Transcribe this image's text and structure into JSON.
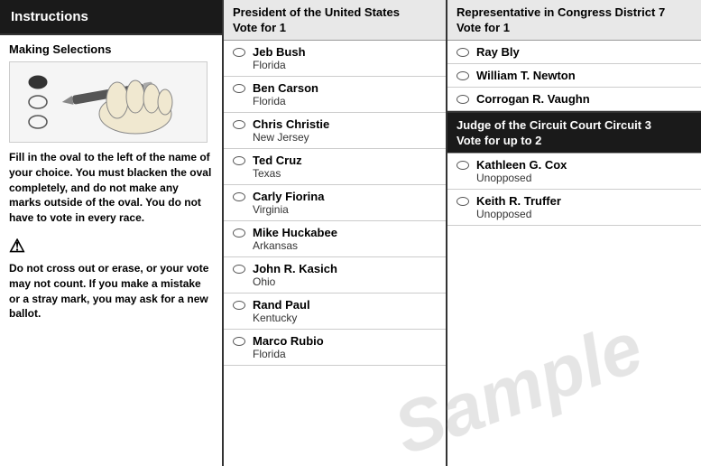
{
  "instructions": {
    "header": "Instructions",
    "making_selections": "Making Selections",
    "fill_in_text": "Fill in the oval to the left of the name of your choice. You must blacken the oval completely, and do not make any marks outside of the oval. You do not have to vote in every race.",
    "warning_text": "Do not cross out or erase, or your vote may not count. If you make a mistake or a stray mark, you may ask for a new ballot."
  },
  "president": {
    "title": "President of the United States",
    "vote_for": "Vote for 1",
    "candidates": [
      {
        "name": "Jeb Bush",
        "state": "Florida"
      },
      {
        "name": "Ben Carson",
        "state": "Florida"
      },
      {
        "name": "Chris Christie",
        "state": "New Jersey"
      },
      {
        "name": "Ted Cruz",
        "state": "Texas"
      },
      {
        "name": "Carly Fiorina",
        "state": "Virginia"
      },
      {
        "name": "Mike Huckabee",
        "state": "Arkansas"
      },
      {
        "name": "John R. Kasich",
        "state": "Ohio"
      },
      {
        "name": "Rand Paul",
        "state": "Kentucky"
      },
      {
        "name": "Marco Rubio",
        "state": "Florida"
      }
    ]
  },
  "congress": {
    "title": "Representative in Congress District 7",
    "vote_for": "Vote for 1",
    "candidates": [
      {
        "name": "Ray Bly",
        "state": ""
      },
      {
        "name": "William T. Newton",
        "state": ""
      },
      {
        "name": "Corrogan R. Vaughn",
        "state": ""
      }
    ]
  },
  "circuit_court": {
    "title": "Judge of the Circuit Court Circuit 3",
    "vote_for": "Vote for up to 2",
    "candidates": [
      {
        "name": "Kathleen G. Cox",
        "state": "Unopposed"
      },
      {
        "name": "Keith R. Truffer",
        "state": "Unopposed"
      }
    ]
  },
  "watermark": "Sample"
}
